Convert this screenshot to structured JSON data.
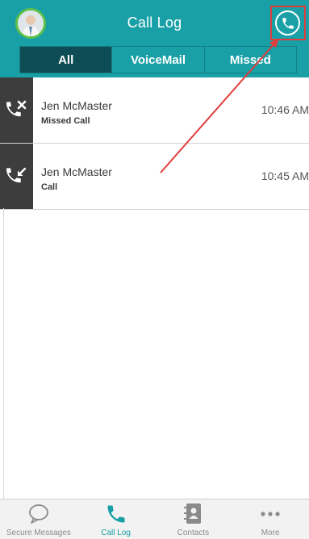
{
  "header": {
    "title": "Call Log",
    "colors": {
      "teal": "#19a0a6",
      "active_segment": "#0e4d55",
      "avatar_ring": "#5cc04a",
      "highlight": "#e03c3c"
    }
  },
  "segments": [
    {
      "label": "All",
      "active": true
    },
    {
      "label": "VoiceMail",
      "active": false
    },
    {
      "label": "Missed",
      "active": false
    }
  ],
  "calls": [
    {
      "name": "Jen McMaster",
      "type": "Missed Call",
      "time": "10:46 AM",
      "icon": "missed-call-icon"
    },
    {
      "name": "Jen McMaster",
      "type": "Call",
      "time": "10:45 AM",
      "icon": "incoming-call-icon"
    }
  ],
  "tabs": [
    {
      "label": "Secure Messages",
      "icon": "chat-bubble-icon",
      "active": false
    },
    {
      "label": "Call Log",
      "icon": "phone-icon",
      "active": true
    },
    {
      "label": "Contacts",
      "icon": "address-book-icon",
      "active": false
    },
    {
      "label": "More",
      "icon": "more-dots-icon",
      "active": false
    }
  ]
}
